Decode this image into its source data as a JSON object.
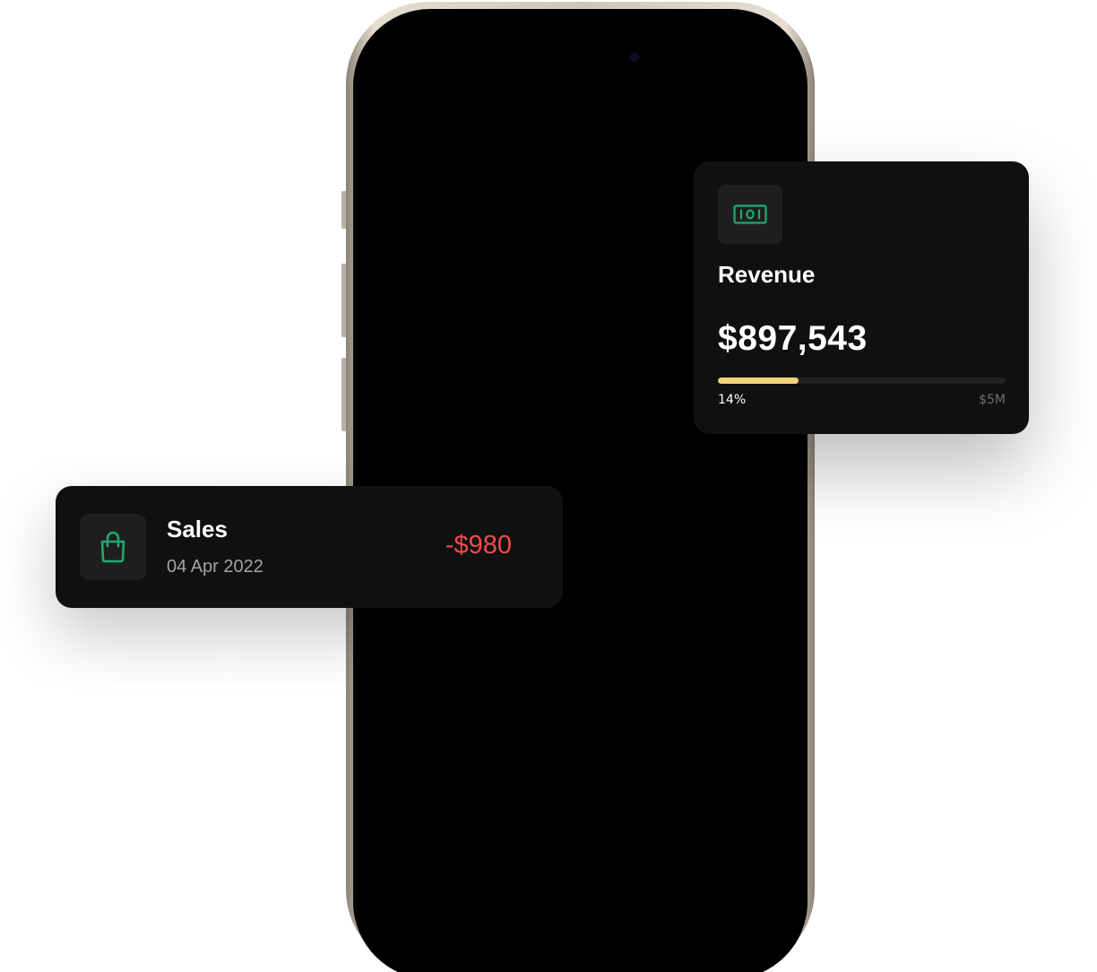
{
  "revenue_card": {
    "icon": "banknote-icon",
    "title": "Revenue",
    "amount": "$897,543",
    "progress": {
      "percent": 14,
      "label": "14%",
      "max_label": "$5M",
      "fill_color": "#f5d27a"
    }
  },
  "sales_card": {
    "icon": "shopping-bag-icon",
    "title": "Sales",
    "date": "04 Apr 2022",
    "amount": "-$980",
    "amount_color": "#ef4b4b"
  },
  "colors": {
    "card_background": "#101010",
    "icon_tile": "#1e1e1e",
    "accent_green": "#1fa971"
  }
}
